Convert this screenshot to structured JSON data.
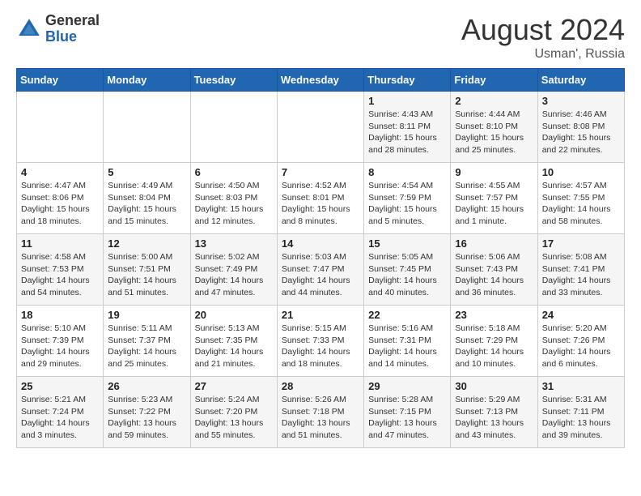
{
  "header": {
    "logo_general": "General",
    "logo_blue": "Blue",
    "month_year": "August 2024",
    "location": "Usman', Russia"
  },
  "weekdays": [
    "Sunday",
    "Monday",
    "Tuesday",
    "Wednesday",
    "Thursday",
    "Friday",
    "Saturday"
  ],
  "weeks": [
    [
      {
        "day": "",
        "info": ""
      },
      {
        "day": "",
        "info": ""
      },
      {
        "day": "",
        "info": ""
      },
      {
        "day": "",
        "info": ""
      },
      {
        "day": "1",
        "info": "Sunrise: 4:43 AM\nSunset: 8:11 PM\nDaylight: 15 hours\nand 28 minutes."
      },
      {
        "day": "2",
        "info": "Sunrise: 4:44 AM\nSunset: 8:10 PM\nDaylight: 15 hours\nand 25 minutes."
      },
      {
        "day": "3",
        "info": "Sunrise: 4:46 AM\nSunset: 8:08 PM\nDaylight: 15 hours\nand 22 minutes."
      }
    ],
    [
      {
        "day": "4",
        "info": "Sunrise: 4:47 AM\nSunset: 8:06 PM\nDaylight: 15 hours\nand 18 minutes."
      },
      {
        "day": "5",
        "info": "Sunrise: 4:49 AM\nSunset: 8:04 PM\nDaylight: 15 hours\nand 15 minutes."
      },
      {
        "day": "6",
        "info": "Sunrise: 4:50 AM\nSunset: 8:03 PM\nDaylight: 15 hours\nand 12 minutes."
      },
      {
        "day": "7",
        "info": "Sunrise: 4:52 AM\nSunset: 8:01 PM\nDaylight: 15 hours\nand 8 minutes."
      },
      {
        "day": "8",
        "info": "Sunrise: 4:54 AM\nSunset: 7:59 PM\nDaylight: 15 hours\nand 5 minutes."
      },
      {
        "day": "9",
        "info": "Sunrise: 4:55 AM\nSunset: 7:57 PM\nDaylight: 15 hours\nand 1 minute."
      },
      {
        "day": "10",
        "info": "Sunrise: 4:57 AM\nSunset: 7:55 PM\nDaylight: 14 hours\nand 58 minutes."
      }
    ],
    [
      {
        "day": "11",
        "info": "Sunrise: 4:58 AM\nSunset: 7:53 PM\nDaylight: 14 hours\nand 54 minutes."
      },
      {
        "day": "12",
        "info": "Sunrise: 5:00 AM\nSunset: 7:51 PM\nDaylight: 14 hours\nand 51 minutes."
      },
      {
        "day": "13",
        "info": "Sunrise: 5:02 AM\nSunset: 7:49 PM\nDaylight: 14 hours\nand 47 minutes."
      },
      {
        "day": "14",
        "info": "Sunrise: 5:03 AM\nSunset: 7:47 PM\nDaylight: 14 hours\nand 44 minutes."
      },
      {
        "day": "15",
        "info": "Sunrise: 5:05 AM\nSunset: 7:45 PM\nDaylight: 14 hours\nand 40 minutes."
      },
      {
        "day": "16",
        "info": "Sunrise: 5:06 AM\nSunset: 7:43 PM\nDaylight: 14 hours\nand 36 minutes."
      },
      {
        "day": "17",
        "info": "Sunrise: 5:08 AM\nSunset: 7:41 PM\nDaylight: 14 hours\nand 33 minutes."
      }
    ],
    [
      {
        "day": "18",
        "info": "Sunrise: 5:10 AM\nSunset: 7:39 PM\nDaylight: 14 hours\nand 29 minutes."
      },
      {
        "day": "19",
        "info": "Sunrise: 5:11 AM\nSunset: 7:37 PM\nDaylight: 14 hours\nand 25 minutes."
      },
      {
        "day": "20",
        "info": "Sunrise: 5:13 AM\nSunset: 7:35 PM\nDaylight: 14 hours\nand 21 minutes."
      },
      {
        "day": "21",
        "info": "Sunrise: 5:15 AM\nSunset: 7:33 PM\nDaylight: 14 hours\nand 18 minutes."
      },
      {
        "day": "22",
        "info": "Sunrise: 5:16 AM\nSunset: 7:31 PM\nDaylight: 14 hours\nand 14 minutes."
      },
      {
        "day": "23",
        "info": "Sunrise: 5:18 AM\nSunset: 7:29 PM\nDaylight: 14 hours\nand 10 minutes."
      },
      {
        "day": "24",
        "info": "Sunrise: 5:20 AM\nSunset: 7:26 PM\nDaylight: 14 hours\nand 6 minutes."
      }
    ],
    [
      {
        "day": "25",
        "info": "Sunrise: 5:21 AM\nSunset: 7:24 PM\nDaylight: 14 hours\nand 3 minutes."
      },
      {
        "day": "26",
        "info": "Sunrise: 5:23 AM\nSunset: 7:22 PM\nDaylight: 13 hours\nand 59 minutes."
      },
      {
        "day": "27",
        "info": "Sunrise: 5:24 AM\nSunset: 7:20 PM\nDaylight: 13 hours\nand 55 minutes."
      },
      {
        "day": "28",
        "info": "Sunrise: 5:26 AM\nSunset: 7:18 PM\nDaylight: 13 hours\nand 51 minutes."
      },
      {
        "day": "29",
        "info": "Sunrise: 5:28 AM\nSunset: 7:15 PM\nDaylight: 13 hours\nand 47 minutes."
      },
      {
        "day": "30",
        "info": "Sunrise: 5:29 AM\nSunset: 7:13 PM\nDaylight: 13 hours\nand 43 minutes."
      },
      {
        "day": "31",
        "info": "Sunrise: 5:31 AM\nSunset: 7:11 PM\nDaylight: 13 hours\nand 39 minutes."
      }
    ]
  ]
}
